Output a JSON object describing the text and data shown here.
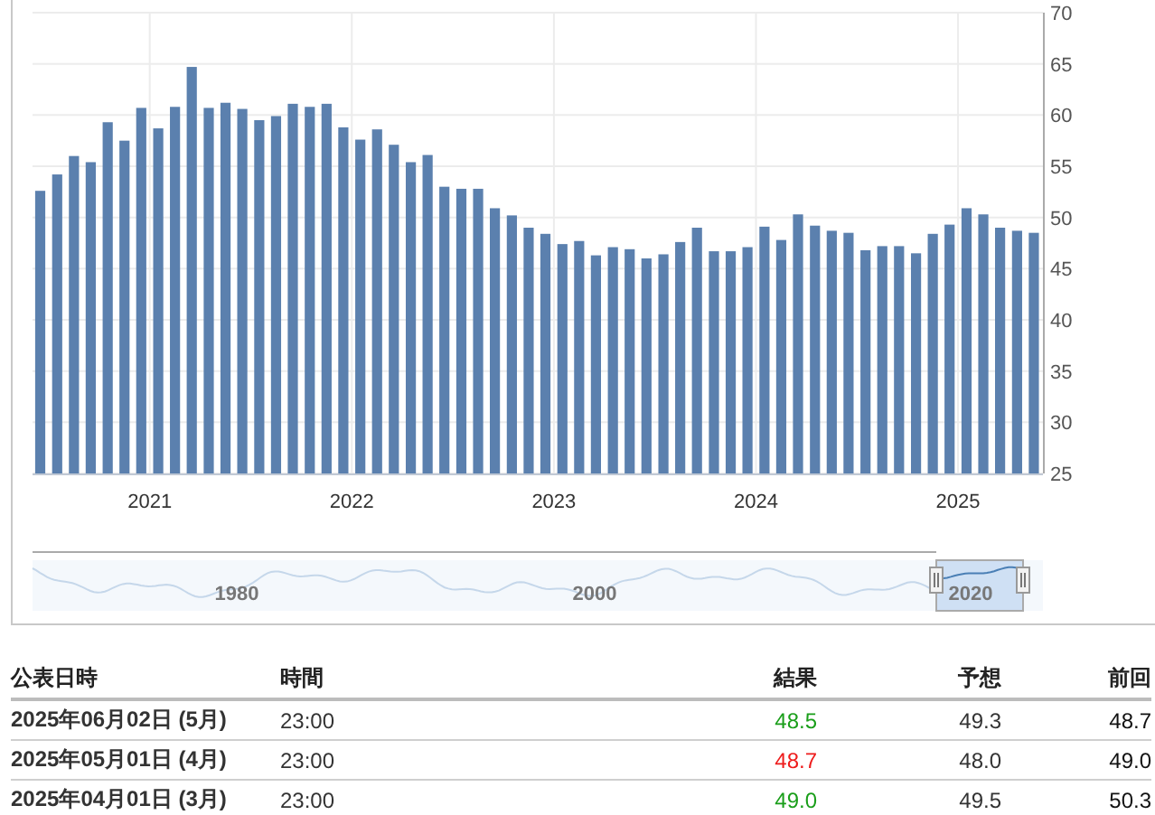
{
  "chart": {
    "chart_data": {
      "type": "bar",
      "x": [
        2020.458,
        2020.542,
        2020.625,
        2020.708,
        2020.792,
        2020.875,
        2020.958,
        2021.042,
        2021.125,
        2021.208,
        2021.292,
        2021.375,
        2021.458,
        2021.542,
        2021.625,
        2021.708,
        2021.792,
        2021.875,
        2021.958,
        2022.042,
        2022.125,
        2022.208,
        2022.292,
        2022.375,
        2022.458,
        2022.542,
        2022.625,
        2022.708,
        2022.792,
        2022.875,
        2022.958,
        2023.042,
        2023.125,
        2023.208,
        2023.292,
        2023.375,
        2023.458,
        2023.542,
        2023.625,
        2023.708,
        2023.792,
        2023.875,
        2023.958,
        2024.042,
        2024.125,
        2024.208,
        2024.292,
        2024.375,
        2024.458,
        2024.542,
        2024.625,
        2024.708,
        2024.792,
        2024.875,
        2024.958,
        2025.042,
        2025.125,
        2025.208,
        2025.292,
        2025.375
      ],
      "series": [
        {
          "color": "#5b80ae",
          "values": [
            52.6,
            54.2,
            56.0,
            55.4,
            59.3,
            57.5,
            60.7,
            58.7,
            60.8,
            64.7,
            60.7,
            61.2,
            60.6,
            59.5,
            59.9,
            61.1,
            60.8,
            61.1,
            58.8,
            57.6,
            58.6,
            57.1,
            55.4,
            56.1,
            53.0,
            52.8,
            52.8,
            50.9,
            50.2,
            49.0,
            48.4,
            47.4,
            47.7,
            46.3,
            47.1,
            46.9,
            46.0,
            46.4,
            47.6,
            49.0,
            46.7,
            46.7,
            47.1,
            49.1,
            47.8,
            50.3,
            49.2,
            48.7,
            48.5,
            46.8,
            47.2,
            47.2,
            46.5,
            48.4,
            49.3,
            50.9,
            50.3,
            49.0,
            48.7,
            48.5
          ]
        }
      ],
      "xlim": [
        2020.42,
        2025.42
      ],
      "ylim": [
        25,
        70
      ],
      "yticks": [
        25,
        30,
        35,
        40,
        45,
        50,
        55,
        60,
        65,
        70
      ],
      "xticks": [
        2021,
        2022,
        2023,
        2024,
        2025
      ],
      "grid": true
    }
  },
  "navigator": {
    "labels": [
      "1980",
      "2000",
      "2020"
    ]
  },
  "table": {
    "columns": [
      "公表日時",
      "時間",
      "結果",
      "予想",
      "前回"
    ],
    "rows": [
      {
        "date": "2025年06月02日 (5月)",
        "time": "23:00",
        "actual": "48.5",
        "color": "#1a9e1a",
        "forecast": "49.3",
        "previous": "48.7"
      },
      {
        "date": "2025年05月01日 (4月)",
        "time": "23:00",
        "actual": "48.7",
        "color": "#ee1c1c",
        "forecast": "48.0",
        "previous": "49.0"
      },
      {
        "date": "2025年04月01日 (3月)",
        "time": "23:00",
        "actual": "49.0",
        "color": "#1a9e1a",
        "forecast": "49.5",
        "previous": "50.3"
      }
    ]
  }
}
